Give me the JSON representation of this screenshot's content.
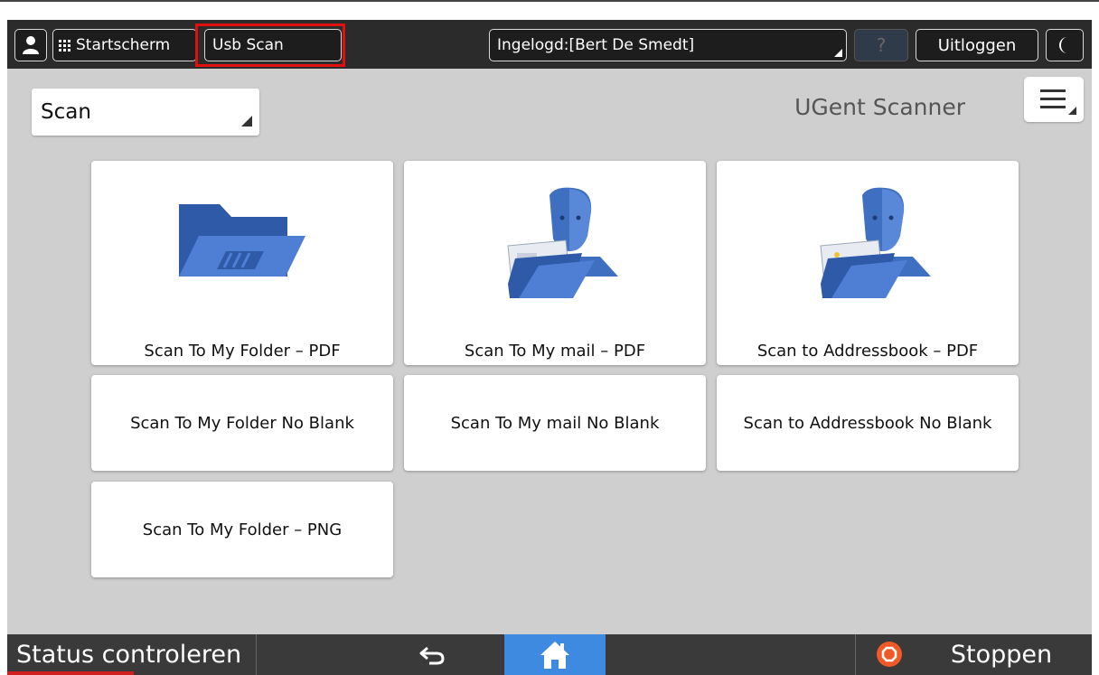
{
  "topbar": {
    "user_icon": "user-icon",
    "home_label": "Startscherm",
    "usb_label": "Usb Scan",
    "login_label": "Ingelogd:[Bert De Smedt]",
    "help_label": "?",
    "logout_label": "Uitloggen",
    "moon_icon": "moon-icon"
  },
  "header": {
    "mode_select": "Scan",
    "title": "UGent Scanner",
    "menu_icon": "hamburger-menu-icon"
  },
  "tiles": [
    {
      "label": "Scan To My Folder – PDF",
      "icon": "folder-icon"
    },
    {
      "label": "Scan To My mail – PDF",
      "icon": "person-mail-icon"
    },
    {
      "label": "Scan to Addressbook – PDF",
      "icon": "person-addressbook-icon"
    },
    {
      "label": "Scan To My Folder No Blank"
    },
    {
      "label": "Scan To My mail No Blank"
    },
    {
      "label": "Scan to Addressbook No Blank"
    },
    {
      "label": "Scan To My Folder – PNG"
    }
  ],
  "bottombar": {
    "status_label": "Status controleren",
    "back_icon": "back-arrow-icon",
    "home_icon": "home-icon",
    "stop_label": "Stoppen"
  },
  "colors": {
    "accent_blue": "#3d8ae0",
    "stop_orange": "#f05a28",
    "highlight_red": "#e01010",
    "icon_blue": "#3f6fc0"
  }
}
